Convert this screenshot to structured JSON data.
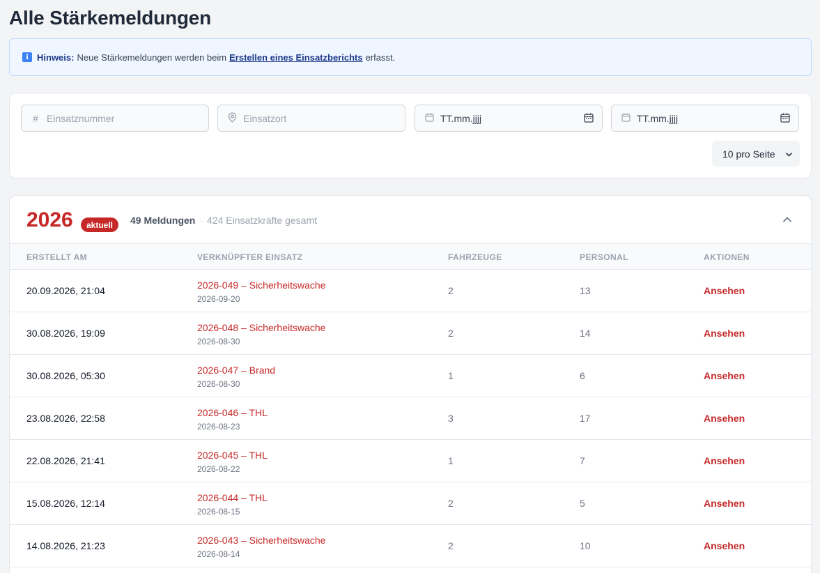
{
  "page": {
    "title": "Alle Stärkemeldungen"
  },
  "notice": {
    "icon": "info-icon",
    "label": "Hinweis:",
    "text_before": "Neue Stärkemeldungen werden beim",
    "link": "Erstellen eines Einsatzberichts",
    "text_after": "erfasst."
  },
  "filters": {
    "operation_number_placeholder": "Einsatznummer",
    "location_placeholder": "Einsatzort",
    "date_from_placeholder": "TT.mm.jjjj",
    "date_to_placeholder": "TT.mm.jjjj",
    "per_page": "10 pro Seite"
  },
  "year_group": {
    "year": "2026",
    "badge": "aktuell",
    "reports_count": "49 Meldungen",
    "total_personnel": "424 Einsatzkräfte gesamt",
    "columns": [
      "ERSTELLT AM",
      "VERKNÜPFTER EINSATZ",
      "FAHRZEUGE",
      "PERSONAL",
      "AKTIONEN"
    ],
    "rows": [
      {
        "created": "20.09.2026, 21:04",
        "operation": "2026-049 – Sicherheitswache",
        "operation_date": "2026-09-20",
        "vehicles": "2",
        "personnel": "13",
        "action": "Ansehen"
      },
      {
        "created": "30.08.2026, 19:09",
        "operation": "2026-048 – Sicherheitswache",
        "operation_date": "2026-08-30",
        "vehicles": "2",
        "personnel": "14",
        "action": "Ansehen"
      },
      {
        "created": "30.08.2026, 05:30",
        "operation": "2026-047 – Brand",
        "operation_date": "2026-08-30",
        "vehicles": "1",
        "personnel": "6",
        "action": "Ansehen"
      },
      {
        "created": "23.08.2026, 22:58",
        "operation": "2026-046 – THL",
        "operation_date": "2026-08-23",
        "vehicles": "3",
        "personnel": "17",
        "action": "Ansehen"
      },
      {
        "created": "22.08.2026, 21:41",
        "operation": "2026-045 – THL",
        "operation_date": "2026-08-22",
        "vehicles": "1",
        "personnel": "7",
        "action": "Ansehen"
      },
      {
        "created": "15.08.2026, 12:14",
        "operation": "2026-044 – THL",
        "operation_date": "2026-08-15",
        "vehicles": "2",
        "personnel": "5",
        "action": "Ansehen"
      },
      {
        "created": "14.08.2026, 21:23",
        "operation": "2026-043 – Sicherheitswache",
        "operation_date": "2026-08-14",
        "vehicles": "2",
        "personnel": "10",
        "action": "Ansehen"
      }
    ]
  },
  "colors": {
    "accent": "#c62828",
    "notice_bg": "#eff6ff",
    "page_bg": "#f3f4f6"
  }
}
